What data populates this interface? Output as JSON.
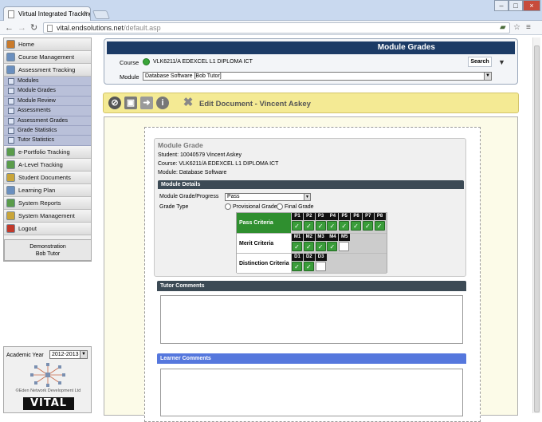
{
  "browser": {
    "tab_title": "Virtual Integrated Tracking",
    "tab_close": "×",
    "url_host": "vital.endsolutions.net",
    "url_path": "/default.asp",
    "window_controls": [
      "–",
      "□",
      "×"
    ]
  },
  "sidebar": {
    "items": [
      {
        "label": "Home",
        "icon": "home-icon",
        "color": "#c97a2b"
      },
      {
        "label": "Course Management",
        "icon": "course-icon",
        "color": "#6a8fbf"
      },
      {
        "label": "Assessment Tracking",
        "icon": "assessment-icon",
        "color": "#6a8fbf"
      }
    ],
    "sub_items": [
      {
        "label": "Modules"
      },
      {
        "label": "Module Grades"
      },
      {
        "label": "Module Review"
      },
      {
        "label": "Assessments"
      },
      {
        "label": "Assessment Grades"
      },
      {
        "label": "Grade Statistics"
      },
      {
        "label": "Tutor Statistics"
      }
    ],
    "items_after": [
      {
        "label": "e-Portfolio Tracking",
        "icon": "portfolio-icon",
        "color": "#5a9c4a"
      },
      {
        "label": "A-Level Tracking",
        "icon": "alevel-icon",
        "color": "#5a9c4a"
      },
      {
        "label": "Student Documents",
        "icon": "documents-icon",
        "color": "#c9a53a"
      },
      {
        "label": "Learning Plan",
        "icon": "learning-plan-icon",
        "color": "#6a8fbf"
      },
      {
        "label": "System Reports",
        "icon": "reports-icon",
        "color": "#5a9c4a"
      },
      {
        "label": "System Management",
        "icon": "management-icon",
        "color": "#c9a53a"
      },
      {
        "label": "Logout",
        "icon": "logout-icon",
        "color": "#c23a2b"
      }
    ],
    "demo_line1": "Demonstration",
    "demo_line2": "Bob Tutor",
    "academic_year_label": "Academic Year",
    "academic_year_value": "2012-2013",
    "logo_caption": "©Eden Network Development Ltd",
    "logo_text": "VITAL"
  },
  "grades_panel": {
    "title": "Module Grades",
    "course_label": "Course",
    "course_value": "VLK6211/A EDEXCEL L1 DIPLOMA ICT",
    "search_label": "Search",
    "module_label": "Module",
    "module_value": "Database Software [Bob Tutor]"
  },
  "toolbar": {
    "title": "Edit Document - Vincent Askey"
  },
  "module_grade": {
    "title": "Module Grade",
    "student_label": "Student:",
    "student_value": "10040579 Vincent Askey",
    "course_label": "Course:",
    "course_value": "VLK6211/A EDEXCEL L1 DIPLOMA ICT",
    "module_label": "Module:",
    "module_value": "Database Software",
    "details_header": "Module Details",
    "grade_progress_label": "Module Grade/Progress",
    "grade_progress_value": "Pass",
    "grade_type_label": "Grade Type",
    "provisional_label": "Provisional Grade",
    "final_label": "Final Grade",
    "criteria": [
      {
        "name": "Pass Criteria",
        "highlight": "#2f8f2f",
        "cells": [
          {
            "label": "P1",
            "checked": true
          },
          {
            "label": "P2",
            "checked": true
          },
          {
            "label": "P3",
            "checked": true
          },
          {
            "label": "P4",
            "checked": true
          },
          {
            "label": "P5",
            "checked": true
          },
          {
            "label": "P6",
            "checked": true
          },
          {
            "label": "P7",
            "checked": true
          },
          {
            "label": "P8",
            "checked": true
          }
        ]
      },
      {
        "name": "Merit Criteria",
        "highlight": "#ffffff",
        "cells": [
          {
            "label": "M1",
            "checked": true
          },
          {
            "label": "M2",
            "checked": true
          },
          {
            "label": "M3",
            "checked": true
          },
          {
            "label": "M4",
            "checked": true
          },
          {
            "label": "M5",
            "checked": false
          }
        ]
      },
      {
        "name": "Distinction Criteria",
        "highlight": "#ffffff",
        "cells": [
          {
            "label": "D1",
            "checked": true
          },
          {
            "label": "D2",
            "checked": true
          },
          {
            "label": "D3",
            "checked": false
          }
        ]
      }
    ]
  },
  "tutor_comments": {
    "header": "Tutor Comments",
    "color": "#3c4a55"
  },
  "learner_comments": {
    "header": "Learner Comments",
    "color": "#5577dd"
  }
}
